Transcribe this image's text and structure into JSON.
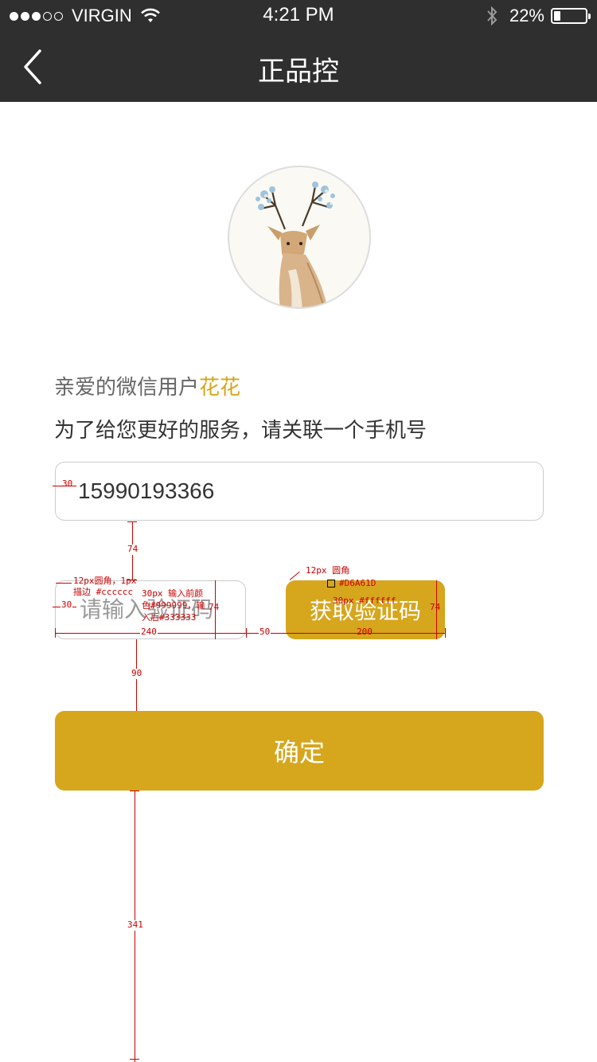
{
  "status_bar": {
    "carrier": "VIRGIN",
    "time": "4:21 PM",
    "battery": "22%",
    "battery_level": 0.22,
    "signal_bars": 3,
    "signal_total": 5
  },
  "nav": {
    "title": "正品控",
    "back_icon": "chevron-left-icon"
  },
  "avatar": {
    "icon": "deer-illustration"
  },
  "greeting": {
    "prefix": "亲爱的微信用户",
    "name": "花花"
  },
  "subtitle": "为了给您更好的服务，请关联一个手机号",
  "phone_input": {
    "value": "15990193366"
  },
  "code_input": {
    "placeholder": "请输入验证码",
    "value": ""
  },
  "code_button": {
    "label": "获取验证码"
  },
  "confirm_button": {
    "label": "确定"
  },
  "colors": {
    "accent": "#D6A61D",
    "nav_bg": "#2f2f2f",
    "border": "#cccccc",
    "placeholder": "#999999",
    "text": "#333333"
  },
  "annotations": {
    "phone_padding": "30",
    "gap_phone_code": "74",
    "code_field_note_1": "12px圆角，1px",
    "code_field_note_2": "描边 #cccccc",
    "code_font_note_1": "30px 输入前颜",
    "code_font_note_2": "色#999999，输",
    "code_font_note_3": "入后#333333",
    "code_padding": "30",
    "code_height": "74",
    "code_width": "240",
    "gap_code_button": "50",
    "button_radius_note": "12px 圆角",
    "button_color_note": "#D6A61D",
    "button_font_note": "30px #ffffff",
    "button_height": "74",
    "button_width": "200",
    "gap_to_confirm": "90",
    "gap_bottom": "341"
  }
}
